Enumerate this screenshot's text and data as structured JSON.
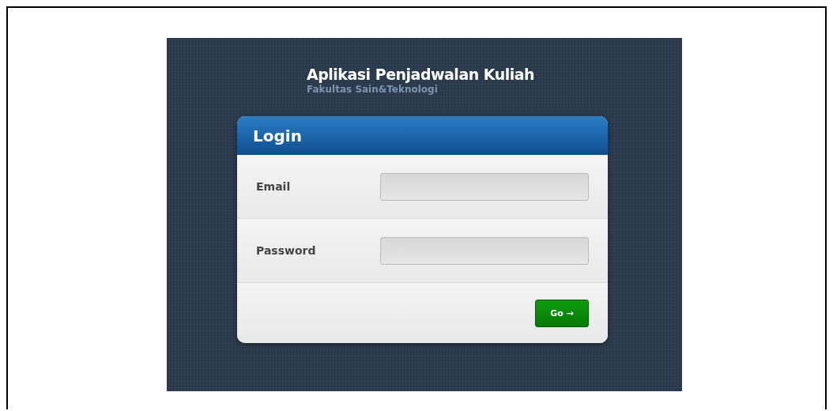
{
  "header": {
    "title": "Aplikasi Penjadwalan Kuliah",
    "subtitle": "Fakultas Sain&Teknologi"
  },
  "login": {
    "title": "Login",
    "fields": [
      {
        "label": "Email"
      },
      {
        "label": "Password"
      }
    ],
    "button": "Go →"
  }
}
